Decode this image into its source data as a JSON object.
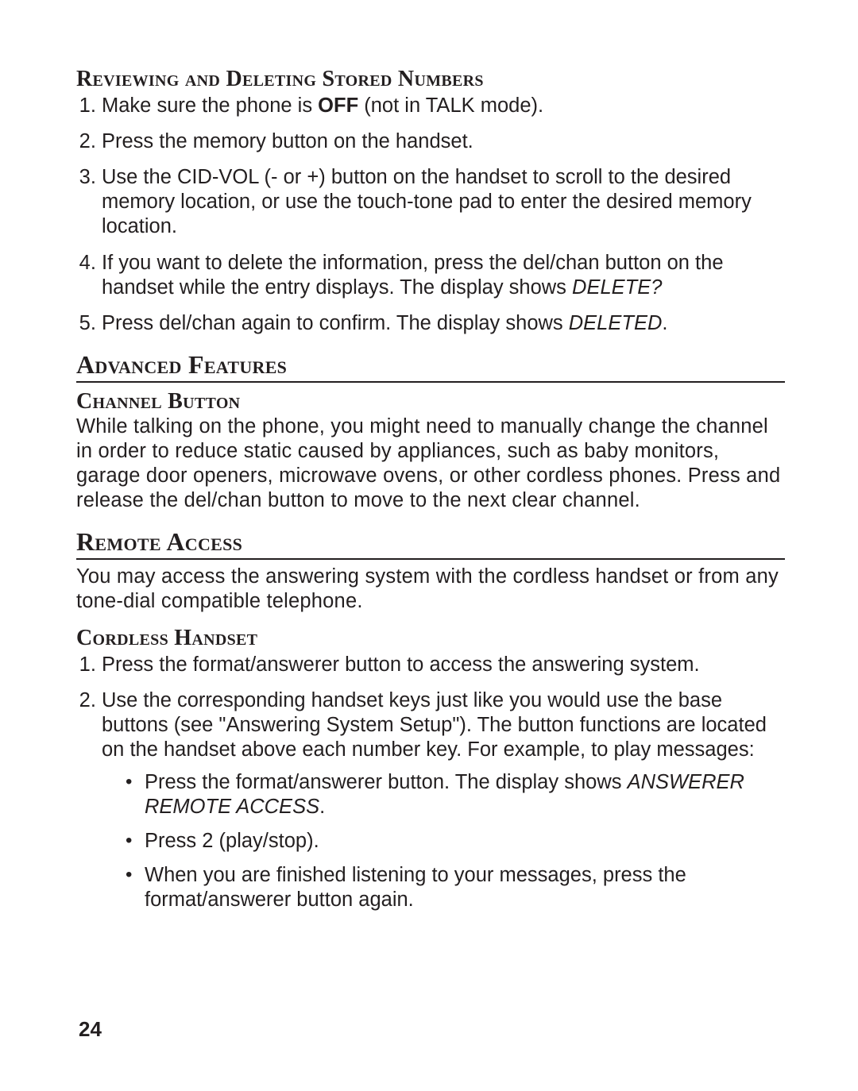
{
  "reviewing": {
    "heading": "Reviewing and Deleting Stored Numbers",
    "steps": [
      {
        "pre": "Make sure the phone is ",
        "bold": "OFF",
        "post": " (not in TALK mode)."
      },
      {
        "text": "Press the memory button on the handset."
      },
      {
        "text": "Use the CID-VOL (- or +) button on the handset to scroll to the desired memory location, or use the touch-tone pad to enter the desired memory location."
      },
      {
        "pre": "If you want to delete the information, press the del/chan button on the handset while the entry displays. The display shows ",
        "ital": "DELETE?"
      },
      {
        "pre": "Press del/chan again to confirm. The display shows ",
        "ital": "DELETED",
        "post": "."
      }
    ]
  },
  "advanced": {
    "heading": "Advanced Features",
    "channel": {
      "heading": "Channel Button",
      "body": "While talking on the phone, you might need to manually change the channel in order to reduce static caused by appliances, such as baby monitors, garage door openers, microwave ovens, or other cordless phones. Press and release the del/chan button to move to the next clear channel."
    }
  },
  "remote": {
    "heading": "Remote Access",
    "intro": "You may access the answering system with the cordless handset or from any tone-dial compatible telephone.",
    "cordless": {
      "heading": "Cordless Handset",
      "steps": [
        {
          "text": "Press the format/answerer button to access the answering system."
        },
        {
          "text": "Use the corresponding handset keys just like you would use the base buttons (see \"Answering System Setup\"). The button functions are located on the handset above each number key. For example, to play messages:",
          "bullets": [
            {
              "pre": "Press the format/answerer button. The display shows ",
              "ital": "ANSWERER REMOTE ACCESS",
              "post": "."
            },
            {
              "text": "Press 2 (play/stop)."
            },
            {
              "text": "When you are finished listening to your messages, press the format/answerer button again."
            }
          ]
        }
      ]
    }
  },
  "page_number": "24"
}
